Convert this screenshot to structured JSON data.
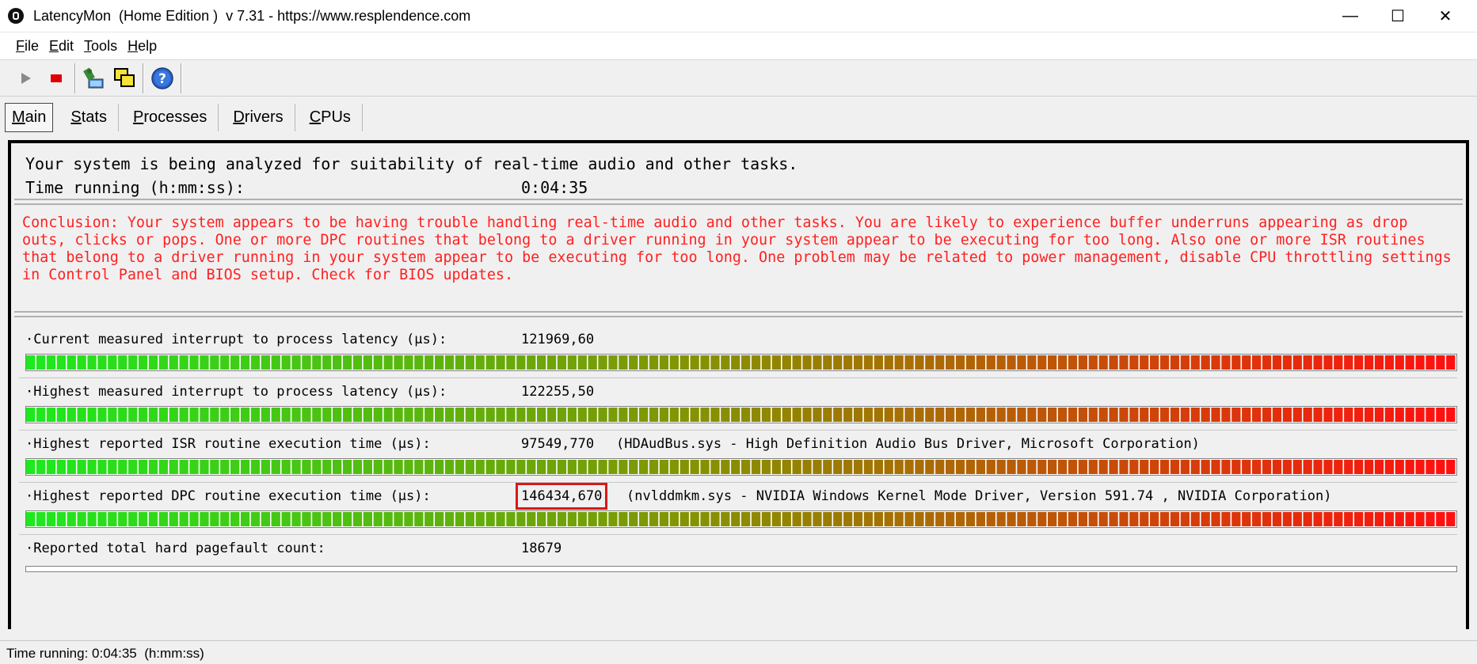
{
  "window": {
    "title": "LatencyMon  (Home Edition )  v 7.31 - https://www.resplendence.com",
    "min_glyph": "—",
    "max_glyph": "☐",
    "close_glyph": "✕"
  },
  "menu": [
    {
      "label": "File",
      "underline": "F",
      "rest": "ile"
    },
    {
      "label": "Edit",
      "underline": "E",
      "rest": "dit"
    },
    {
      "label": "Tools",
      "underline": "T",
      "rest": "ools"
    },
    {
      "label": "Help",
      "underline": "H",
      "rest": "elp"
    }
  ],
  "toolbar": {
    "icons": [
      "play-icon",
      "stop-icon",
      "analyze-icon",
      "windows-icon",
      "help-icon"
    ]
  },
  "tabs": [
    {
      "label": "Main",
      "underline": "M",
      "rest": "ain",
      "active": true
    },
    {
      "label": "Stats",
      "underline": "S",
      "rest": "tats",
      "active": false
    },
    {
      "label": "Processes",
      "underline": "P",
      "rest": "rocesses",
      "active": false
    },
    {
      "label": "Drivers",
      "underline": "D",
      "rest": "rivers",
      "active": false
    },
    {
      "label": "CPUs",
      "underline": "C",
      "rest": "PUs",
      "active": false
    }
  ],
  "main": {
    "analysis_text": "Your system is being analyzed for suitability of real-time audio and other tasks.",
    "time_label": "Time running (h:mm:ss):",
    "time_value": "0:04:35",
    "conclusion": "Conclusion: Your system appears to be having trouble handling real-time audio and other tasks. You are likely to experience buffer underruns appearing as drop outs, clicks or pops. One or more DPC routines that belong to a driver running in your system appear to be executing for too long. Also one or more ISR routines that belong to a driver running in your system appear to be executing for too long. One problem may be related to power management, disable CPU throttling settings in Control Panel and BIOS setup. Check for BIOS updates.",
    "conclusion_color": "#ff2020",
    "metrics": [
      {
        "label": "·Current measured interrupt to process latency (µs):",
        "value": "121969,60",
        "extra": "",
        "fill": 1.0
      },
      {
        "label": "·Highest measured interrupt to process latency (µs):",
        "value": "122255,50",
        "extra": "",
        "fill": 1.0
      },
      {
        "label": "·Highest reported ISR routine execution time (µs):",
        "value": "97549,770",
        "extra": "(HDAudBus.sys - High Definition Audio Bus Driver, Microsoft Corporation)",
        "fill": 1.0
      },
      {
        "label": "·Highest reported DPC routine execution time (µs):",
        "value": "146434,670",
        "extra": "(nvlddmkm.sys - NVIDIA Windows Kernel Mode Driver, Version 591.74 , NVIDIA Corporation)",
        "fill": 1.0,
        "highlight": true
      },
      {
        "label": "·Reported total hard pagefault count:",
        "value": "18679",
        "extra": "",
        "fill": 0
      }
    ]
  },
  "status": {
    "text": "Time running: 0:04:35  (h:mm:ss)"
  },
  "colors": {
    "bar_start": "#1ee81e",
    "bar_mid": "#8c8c00",
    "bar_end": "#ff1010",
    "highlight": "#d81818"
  }
}
